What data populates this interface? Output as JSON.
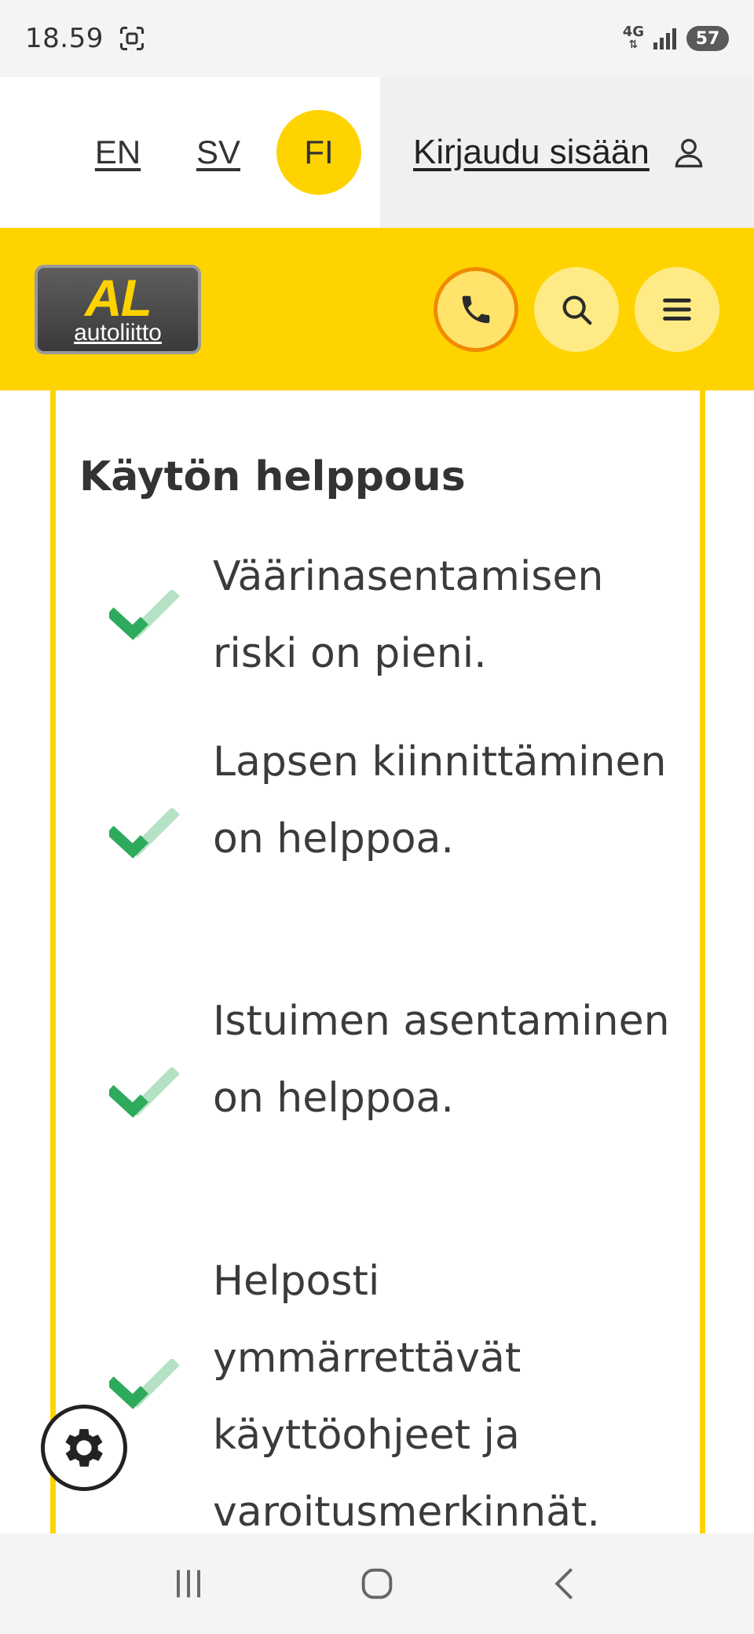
{
  "status_bar": {
    "time": "18.59",
    "network": "4G",
    "battery": "57"
  },
  "language_bar": {
    "languages": [
      {
        "code": "EN",
        "active": false
      },
      {
        "code": "SV",
        "active": false
      },
      {
        "code": "FI",
        "active": true
      }
    ],
    "login_label": "Kirjaudu sisään"
  },
  "header": {
    "logo_mark": "AL",
    "logo_text": "autoliitto",
    "actions": [
      "phone-icon",
      "search-icon",
      "menu-icon"
    ]
  },
  "content": {
    "title": "Käytön helppous",
    "features": [
      {
        "text": "Väärinasentamisen riski on pieni."
      },
      {
        "text": "Lapsen kiinnittäminen on helppoa."
      },
      {
        "text": "Istuimen asentaminen on helppoa."
      },
      {
        "text": "Helposti ymmärrettävät käyttöohjeet ja varoitusmerkinnät."
      }
    ]
  },
  "colors": {
    "brand_yellow": "#ffd300",
    "check_dark": "#2eaa5c",
    "check_light": "#b5e2c4",
    "focus_orange": "#f08a00"
  }
}
